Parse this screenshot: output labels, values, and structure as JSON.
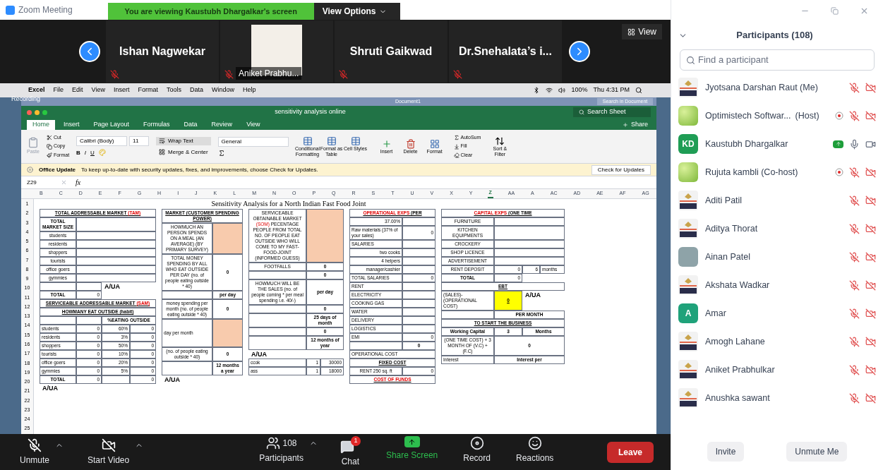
{
  "window": {
    "title": "Zoom Meeting"
  },
  "share_banner": {
    "text": "You are viewing Kaustubh Dhargalkar's screen",
    "options": "View Options"
  },
  "filmstrip": {
    "view": "View",
    "tiles": [
      {
        "name": "Ishan Nagwekar",
        "kind": "name",
        "muted": true
      },
      {
        "name": "Aniket Prabhu...",
        "kind": "picture",
        "muted": true
      },
      {
        "name": "Shruti Gaikwad",
        "kind": "name",
        "muted": true
      },
      {
        "name": "Dr.Snehalata’s i...",
        "kind": "name",
        "muted": true
      }
    ]
  },
  "shared_screen": {
    "menubar": {
      "app": "Excel",
      "menus": [
        "File",
        "Edit",
        "View",
        "Insert",
        "Format",
        "Tools",
        "Data",
        "Window",
        "Help"
      ],
      "battery": "100%",
      "clock": "Thu 4:31 PM"
    },
    "recording": "Recording",
    "background_window": {
      "title": "Document1",
      "search": "Search in Document"
    },
    "excel": {
      "title": "sensitivity analysis online",
      "search": "Search Sheet",
      "share": "Share",
      "tabs": [
        {
          "label": "Home",
          "selected": true
        },
        {
          "label": "Insert",
          "selected": false
        },
        {
          "label": "Page Layout",
          "selected": false
        },
        {
          "label": "Formulas",
          "selected": false
        },
        {
          "label": "Data",
          "selected": false
        },
        {
          "label": "Review",
          "selected": false
        },
        {
          "label": "View",
          "selected": false
        }
      ],
      "ribbon": {
        "paste": {
          "label": "Paste",
          "disabled": true
        },
        "clipboard": [
          "Cut",
          "Copy",
          "Format"
        ],
        "font": "Calibri (Body)",
        "size": "11",
        "styles": [
          "B",
          "I",
          "U"
        ],
        "wrap": "Wrap Text",
        "merge": "Merge & Center",
        "number_format": "General",
        "style_buttons": [
          "Conditional Formatting",
          "Format as Table",
          "Cell Styles"
        ],
        "cell_buttons": [
          "Insert",
          "Delete",
          "Format"
        ],
        "edit_buttons": [
          "AutoSum",
          "Fill",
          "Clear"
        ],
        "sort": "Sort & Filter"
      },
      "update": {
        "title": "Office Update",
        "message": "To keep up-to-date with security updates, fixes, and improvements, choose Check for Updates.",
        "button": "Check for Updates"
      },
      "name_box": "Z29",
      "fx": "fx",
      "columns": [
        {
          "label": "B",
          "selected": false
        },
        {
          "label": "C",
          "selected": false
        },
        {
          "label": "D",
          "selected": false
        },
        {
          "label": "E",
          "selected": false
        },
        {
          "label": "F",
          "selected": false
        },
        {
          "label": "G",
          "selected": false
        },
        {
          "label": "H",
          "selected": false
        },
        {
          "label": "I",
          "selected": false
        },
        {
          "label": "J",
          "selected": false
        },
        {
          "label": "K",
          "selected": false
        },
        {
          "label": "L",
          "selected": false
        },
        {
          "label": "M",
          "selected": false
        },
        {
          "label": "N",
          "selected": false
        },
        {
          "label": "O",
          "selected": false
        },
        {
          "label": "P",
          "selected": false
        },
        {
          "label": "Q",
          "selected": false
        },
        {
          "label": "R",
          "selected": false
        },
        {
          "label": "S",
          "selected": false
        },
        {
          "label": "T",
          "selected": false
        },
        {
          "label": "U",
          "selected": false
        },
        {
          "label": "V",
          "selected": false
        },
        {
          "label": "X",
          "selected": false
        },
        {
          "label": "Y",
          "selected": false
        },
        {
          "label": "Z",
          "selected": true
        },
        {
          "label": "AA",
          "selected": false
        },
        {
          "label": "A",
          "selected": false
        },
        {
          "label": "AC",
          "selected": false
        },
        {
          "label": "AD",
          "selected": false
        },
        {
          "label": "AE",
          "selected": false
        },
        {
          "label": "AF",
          "selected": false
        },
        {
          "label": "AG",
          "selected": false
        }
      ],
      "rows": [
        "1",
        "2",
        "3",
        "4",
        "5",
        "6",
        "7",
        "8",
        "9",
        "10",
        "11",
        "12",
        "13",
        "14",
        "15",
        "16",
        "17",
        "18",
        "19",
        "20",
        "21",
        "22",
        "23",
        "24",
        "25"
      ],
      "sheet_title": "Sensitivity Analysis for a North Indian Fast Food Joint",
      "panels": [
        {
          "rows": [
            {
              "cells": [
                {
                  "kind": "heading",
                  "parts": [
                    {
                      "text": "TOTAL ADDRESSABLE MARKET ",
                      "kind": "plain"
                    },
                    {
                      "text": "(TAM)",
                      "kind": "accent"
                    }
                  ]
                }
              ]
            },
            {
              "cells": [
                {
                  "kind": "bold",
                  "text": "TOTAL MARKET SIZE"
                },
                {
                  "kind": "blank"
                }
              ]
            },
            {
              "cells": [
                {
                  "kind": "center",
                  "text": "students"
                },
                {
                  "kind": "blank"
                }
              ]
            },
            {
              "cells": [
                {
                  "kind": "center",
                  "text": "residents"
                },
                {
                  "kind": "blank"
                }
              ]
            },
            {
              "cells": [
                {
                  "kind": "center",
                  "text": "shoppers"
                },
                {
                  "kind": "blank"
                }
              ]
            },
            {
              "cells": [
                {
                  "kind": "center",
                  "text": "tourists"
                },
                {
                  "kind": "blank"
                }
              ]
            },
            {
              "cells": [
                {
                  "kind": "center",
                  "text": "office goers"
                },
                {
                  "kind": "blank"
                }
              ]
            },
            {
              "cells": [
                {
                  "kind": "center",
                  "text": "gymmies"
                },
                {
                  "kind": "blank"
                }
              ]
            },
            {
              "cells": [
                {
                  "kind": "blank"
                },
                {
                  "kind": "blank"
                },
                {
                  "kind": "note",
                  "text": "A/UA"
                }
              ]
            },
            {
              "cells": [
                {
                  "kind": "bold",
                  "text": "TOTAL"
                },
                {
                  "kind": "value",
                  "text": "0"
                }
              ]
            },
            {
              "cells": [
                {
                  "kind": "heading",
                  "parts": [
                    {
                      "text": "SERVICEABLE ADDRESSABLE MARKET ",
                      "kind": "plain"
                    },
                    {
                      "text": "(SAM)",
                      "kind": "accent"
                    }
                  ]
                }
              ]
            },
            {
              "cells": [
                {
                  "kind": "heading",
                  "parts": [
                    {
                      "text": "HOWMANY EAT OUTSIDE (habit)",
                      "kind": "plain"
                    }
                  ]
                }
              ]
            },
            {
              "cells": [
                {
                  "kind": "blank"
                },
                {
                  "kind": "blank"
                },
                {
                  "kind": "bold",
                  "text": "%EATING OUTSIDE"
                }
              ]
            },
            {
              "cells": [
                {
                  "kind": "label",
                  "text": "students"
                },
                {
                  "kind": "value",
                  "text": "0"
                },
                {
                  "kind": "value",
                  "text": "60%"
                },
                {
                  "kind": "value",
                  "text": "0"
                }
              ]
            },
            {
              "cells": [
                {
                  "kind": "label",
                  "text": "residents"
                },
                {
                  "kind": "value",
                  "text": "0"
                },
                {
                  "kind": "value",
                  "text": "3%"
                },
                {
                  "kind": "value",
                  "text": "0"
                }
              ]
            },
            {
              "cells": [
                {
                  "kind": "label",
                  "text": "shoppers"
                },
                {
                  "kind": "value",
                  "text": "0"
                },
                {
                  "kind": "value",
                  "text": "50%"
                },
                {
                  "kind": "value",
                  "text": "0"
                }
              ]
            },
            {
              "cells": [
                {
                  "kind": "label",
                  "text": "tourists"
                },
                {
                  "kind": "value",
                  "text": "0"
                },
                {
                  "kind": "value",
                  "text": "10%"
                },
                {
                  "kind": "value",
                  "text": "0"
                }
              ]
            },
            {
              "cells": [
                {
                  "kind": "label",
                  "text": "office goers"
                },
                {
                  "kind": "value",
                  "text": "0"
                },
                {
                  "kind": "value",
                  "text": "20%"
                },
                {
                  "kind": "value",
                  "text": "0"
                }
              ]
            },
            {
              "cells": [
                {
                  "kind": "label",
                  "text": "gymmies"
                },
                {
                  "kind": "value",
                  "text": "0"
                },
                {
                  "kind": "value",
                  "text": "5%"
                },
                {
                  "kind": "value",
                  "text": "0"
                }
              ]
            },
            {
              "cells": [
                {
                  "kind": "bold",
                  "text": "TOTAL"
                },
                {
                  "kind": "value",
                  "text": "0"
                },
                {
                  "kind": "blank"
                },
                {
                  "kind": "value",
                  "text": "0"
                }
              ]
            },
            {
              "cells": [
                {
                  "kind": "note",
                  "text": "A/UA"
                }
              ]
            }
          ]
        },
        {
          "rows": [
            {
              "cells": [
                {
                  "kind": "heading",
                  "parts": [
                    {
                      "text": "MARKET (CUSTOMER SPENDING POWER)",
                      "kind": "plain"
                    }
                  ]
                }
              ]
            },
            {
              "cells": [
                {
                  "kind": "center",
                  "text": "HOWMUCH AN PERSON SPENDS ON A MEAL (AN AVERAGE) (BY PRIMARY SURVEY)"
                },
                {
                  "kind": "input"
                }
              ]
            },
            {
              "cells": [
                {
                  "kind": "center",
                  "text": "TOTAL MONEY SPENDING BY ALL WHO EAT OUTSIDE PER DAY (no. of people eating outside * 40)"
                },
                {
                  "kind": "bold",
                  "text": "0"
                }
              ]
            },
            {
              "cells": [
                {
                  "kind": "blank"
                },
                {
                  "kind": "bold",
                  "text": "per day"
                }
              ]
            },
            {
              "cells": [
                {
                  "kind": "center",
                  "text": "money spending per month (no. of people eating outside * 40)"
                },
                {
                  "kind": "bold",
                  "text": "0"
                }
              ]
            },
            {
              "cells": [
                {
                  "kind": "label",
                  "text": "day per month"
                },
                {
                  "kind": "input"
                }
              ]
            },
            {
              "cells": [
                {
                  "kind": "center",
                  "text": "(no. of people eating outside * 40)"
                },
                {
                  "kind": "bold",
                  "text": "0"
                }
              ]
            },
            {
              "cells": [
                {
                  "kind": "blank"
                },
                {
                  "kind": "bold",
                  "text": "12 months a year"
                }
              ]
            },
            {
              "cells": [
                {
                  "kind": "note",
                  "text": "A/UA"
                }
              ]
            }
          ]
        },
        {
          "rows": [
            {
              "cells": [
                {
                  "kind": "center",
                  "parts": [
                    {
                      "text": "SERVICEABLE OBTAINABLE MARKET ",
                      "kind": "plain"
                    },
                    {
                      "text": "(SOM)",
                      "kind": "accent"
                    },
                    {
                      "text": " PECENTAGE PEOPLE FROM TOTAL NO. OF PEOPLE EAT OUTSIDE WHO WILL COME TO MY FAST-FOOD-JOINT (INFORMED GUESS)",
                      "kind": "plain"
                    }
                  ]
                },
                {
                  "kind": "input"
                }
              ]
            },
            {
              "cells": [
                {
                  "kind": "center",
                  "text": "FOOTFALLS"
                },
                {
                  "kind": "bold",
                  "text": "0"
                }
              ]
            },
            {
              "cells": [
                {
                  "kind": "blank"
                },
                {
                  "kind": "bold",
                  "text": "0"
                }
              ]
            },
            {
              "cells": [
                {
                  "kind": "center",
                  "text": "HOWMUCH WILL BE THE SALES (no. of people coming * per meal spending i.e. 40/-)"
                },
                {
                  "kind": "bold",
                  "text": "per day"
                }
              ]
            },
            {
              "cells": [
                {
                  "kind": "blank"
                },
                {
                  "kind": "bold",
                  "text": "0"
                }
              ]
            },
            {
              "cells": [
                {
                  "kind": "blank"
                },
                {
                  "kind": "bold",
                  "text": "25 days of month"
                }
              ]
            },
            {
              "cells": [
                {
                  "kind": "blank"
                },
                {
                  "kind": "bold",
                  "text": "0"
                }
              ]
            },
            {
              "cells": [
                {
                  "kind": "blank"
                },
                {
                  "kind": "bold",
                  "text": "12 months of year"
                }
              ]
            },
            {
              "cells": [
                {
                  "kind": "note",
                  "text": "A/UA"
                }
              ]
            },
            {
              "cells": [
                {
                  "kind": "label",
                  "text": "ccok"
                },
                {
                  "kind": "value",
                  "text": "1"
                },
                {
                  "kind": "value",
                  "text": "30000"
                }
              ]
            },
            {
              "cells": [
                {
                  "kind": "label",
                  "text": "ass"
                },
                {
                  "kind": "value",
                  "text": "1"
                },
                {
                  "kind": "value",
                  "text": "18000"
                }
              ]
            }
          ]
        },
        {
          "rows": [
            {
              "cells": [
                {
                  "kind": "heading",
                  "parts": [
                    {
                      "text": "OPERATIONAL EXPS ",
                      "kind": "accent"
                    },
                    {
                      "text": "(PER",
                      "kind": "plain"
                    }
                  ]
                }
              ]
            },
            {
              "cells": [
                {
                  "kind": "value",
                  "text": "37.00%"
                },
                {
                  "kind": "blank"
                }
              ]
            },
            {
              "cells": [
                {
                  "kind": "label",
                  "text": "Raw materials (37% of your sales)"
                },
                {
                  "kind": "value",
                  "text": "0"
                }
              ]
            },
            {
              "cells": [
                {
                  "kind": "label",
                  "text": "SALARIES"
                },
                {
                  "kind": "blank"
                }
              ]
            },
            {
              "cells": [
                {
                  "kind": "value",
                  "text": "two cooks"
                },
                {
                  "kind": "blank"
                }
              ]
            },
            {
              "cells": [
                {
                  "kind": "value",
                  "text": "4 helpers"
                },
                {
                  "kind": "blank"
                }
              ]
            },
            {
              "cells": [
                {
                  "kind": "value",
                  "text": "manager/cashier"
                },
                {
                  "kind": "blank"
                }
              ]
            },
            {
              "cells": [
                {
                  "kind": "label",
                  "text": "TOTAL SALARIES"
                },
                {
                  "kind": "value",
                  "text": "0"
                }
              ]
            },
            {
              "cells": [
                {
                  "kind": "label",
                  "text": "RENT"
                },
                {
                  "kind": "blank"
                }
              ]
            },
            {
              "cells": [
                {
                  "kind": "label",
                  "text": "ELECTRICITY"
                },
                {
                  "kind": "blank"
                }
              ]
            },
            {
              "cells": [
                {
                  "kind": "label",
                  "text": "COOKING GAS"
                },
                {
                  "kind": "blank"
                }
              ]
            },
            {
              "cells": [
                {
                  "kind": "label",
                  "text": "WATER"
                },
                {
                  "kind": "blank"
                }
              ]
            },
            {
              "cells": [
                {
                  "kind": "label",
                  "text": "DELIVERY"
                },
                {
                  "kind": "blank"
                }
              ]
            },
            {
              "cells": [
                {
                  "kind": "label",
                  "text": "LOGISTICS"
                },
                {
                  "kind": "blank"
                }
              ]
            },
            {
              "cells": [
                {
                  "kind": "label",
                  "text": "EMI"
                },
                {
                  "kind": "value",
                  "text": "0"
                }
              ]
            },
            {
              "cells": [
                {
                  "kind": "blank"
                },
                {
                  "kind": "bold",
                  "text": "0"
                }
              ]
            },
            {
              "cells": [
                {
                  "kind": "label",
                  "text": "OPERATIONAL COST"
                }
              ]
            },
            {
              "cells": [
                {
                  "kind": "heading",
                  "parts": [
                    {
                      "text": "FIXED COST",
                      "kind": "plain"
                    }
                  ]
                }
              ]
            },
            {
              "cells": [
                {
                  "kind": "center",
                  "text": "RENT 250 sq. ft"
                },
                {
                  "kind": "value",
                  "text": "0"
                }
              ]
            },
            {
              "cells": [
                {
                  "kind": "heading",
                  "parts": [
                    {
                      "text": "COST OF FUNDS",
                      "kind": "accent"
                    }
                  ]
                }
              ]
            }
          ]
        },
        {
          "rows": [
            {
              "cells": [
                {
                  "kind": "heading",
                  "parts": [
                    {
                      "text": "CAPITAL EXPS ",
                      "kind": "accent"
                    },
                    {
                      "text": "(ONE TIME",
                      "kind": "plain"
                    }
                  ]
                }
              ]
            },
            {
              "cells": [
                {
                  "kind": "center",
                  "text": "FURNITURE"
                },
                {
                  "kind": "blank"
                }
              ]
            },
            {
              "cells": [
                {
                  "kind": "center",
                  "text": "KITCHEN EQUIPMENTS"
                },
                {
                  "kind": "blank"
                }
              ]
            },
            {
              "cells": [
                {
                  "kind": "center",
                  "text": "CROCKERY"
                },
                {
                  "kind": "blank"
                }
              ]
            },
            {
              "cells": [
                {
                  "kind": "center",
                  "text": "SHOP LICENCE"
                },
                {
                  "kind": "blank"
                }
              ]
            },
            {
              "cells": [
                {
                  "kind": "center",
                  "text": "ADVERTISEMENT"
                },
                {
                  "kind": "blank"
                }
              ]
            },
            {
              "cells": [
                {
                  "kind": "center",
                  "text": "RENT DEPOSIT"
                },
                {
                  "kind": "value",
                  "text": "0"
                },
                {
                  "kind": "value",
                  "text": "6"
                },
                {
                  "kind": "label",
                  "text": "months"
                }
              ]
            },
            {
              "cells": [
                {
                  "kind": "bold",
                  "text": "TOTAL"
                },
                {
                  "kind": "value",
                  "text": "0"
                }
              ]
            },
            {
              "cells": [
                {
                  "kind": "heading",
                  "parts": [
                    {
                      "text": "EBT",
                      "kind": "plain"
                    }
                  ]
                }
              ]
            },
            {
              "cells": [
                {
                  "kind": "label",
                  "text": "(SALES)-(OPERATIONAL COST)"
                },
                {
                  "kind": "result",
                  "text": "0"
                },
                {
                  "kind": "note",
                  "text": "A/UA"
                }
              ]
            },
            {
              "cells": [
                {
                  "kind": "blank"
                },
                {
                  "kind": "bold",
                  "text": "PER MONTH"
                }
              ]
            },
            {
              "cells": [
                {
                  "kind": "heading",
                  "parts": [
                    {
                      "text": "TO START THE BUSINESS",
                      "kind": "plain"
                    }
                  ]
                }
              ]
            },
            {
              "cells": [
                {
                  "kind": "bold",
                  "text": "Working Capital"
                },
                {
                  "kind": "bold",
                  "text": "3"
                },
                {
                  "kind": "bold",
                  "text": "Months"
                }
              ]
            },
            {
              "cells": [
                {
                  "kind": "center",
                  "text": "(ONE TIME COST) + 3 MONTH OF (V.C) + (F.C)"
                },
                {
                  "kind": "bold",
                  "text": "0"
                }
              ]
            },
            {
              "cells": [
                {
                  "kind": "label",
                  "text": "Interest"
                },
                {
                  "kind": "bold",
                  "text": "Interest per"
                }
              ]
            }
          ]
        }
      ]
    }
  },
  "participants": {
    "title": "Participants (108)",
    "search": "Find a participant",
    "buttons": [
      "Invite",
      "Unmute Me"
    ],
    "list": [
      {
        "name": "Jyotsana Darshan Raut (Me)",
        "avatar": {
          "kind": "logo"
        },
        "muted": true,
        "video_off": true
      },
      {
        "name": "Optimistech Softwar...",
        "role": "(Host)",
        "avatar": {
          "kind": "leaves"
        },
        "recording": true,
        "muted": true,
        "video_off": true
      },
      {
        "name": "Kaustubh Dhargalkar",
        "avatar": {
          "kind": "initials",
          "initials": "KD",
          "color": "#1f9d55"
        },
        "sharing": true,
        "muted": false,
        "video_off": false
      },
      {
        "name": "Rujuta kambli (Co-host)",
        "avatar": {
          "kind": "leaves"
        },
        "recording": true,
        "muted": true,
        "video_off": true
      },
      {
        "name": "Aditi Patil",
        "avatar": {
          "kind": "logo"
        },
        "muted": true,
        "video_off": true
      },
      {
        "name": "Aditya Thorat",
        "avatar": {
          "kind": "logo"
        },
        "muted": true,
        "video_off": true
      },
      {
        "name": "Ainan Patel",
        "avatar": {
          "kind": "photo"
        },
        "muted": true,
        "video_off": true
      },
      {
        "name": "Akshata Wadkar",
        "avatar": {
          "kind": "logo"
        },
        "muted": true,
        "video_off": true
      },
      {
        "name": "Amar",
        "avatar": {
          "kind": "initials",
          "initials": "A",
          "color": "#1fa27a"
        },
        "muted": true,
        "video_off": true
      },
      {
        "name": "Amogh Lahane",
        "avatar": {
          "kind": "logo"
        },
        "muted": true,
        "video_off": true
      },
      {
        "name": "Aniket Prabhulkar",
        "avatar": {
          "kind": "logo"
        },
        "muted": true,
        "video_off": true
      },
      {
        "name": "Anushka sawant",
        "avatar": {
          "kind": "logo"
        },
        "muted": true,
        "video_off": true
      }
    ]
  },
  "toolbar": {
    "leave": "Leave",
    "items": [
      {
        "kind": "mic",
        "label": "Unmute",
        "menu": true
      },
      {
        "kind": "video",
        "label": "Start Video",
        "menu": true
      },
      {
        "kind": "participants",
        "label": "Participants",
        "count": "108",
        "menu": true
      },
      {
        "kind": "chat",
        "label": "Chat",
        "badge": "1"
      },
      {
        "kind": "share",
        "label": "Share Screen"
      },
      {
        "kind": "record",
        "label": "Record"
      },
      {
        "kind": "reactions",
        "label": "Reactions"
      }
    ]
  }
}
